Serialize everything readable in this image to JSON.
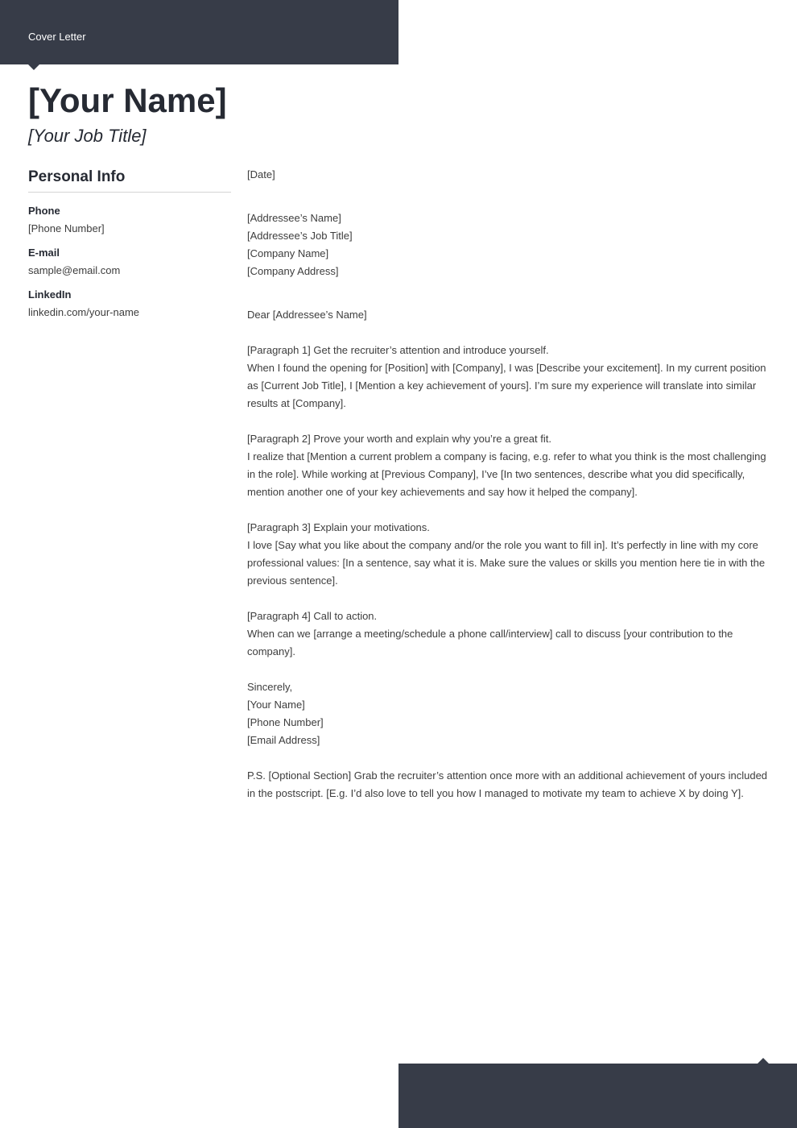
{
  "header": {
    "doc_type": "Cover Letter"
  },
  "applicant": {
    "name": "[Your Name]",
    "job_title": "[Your Job Title]"
  },
  "sidebar": {
    "section_title": "Personal Info",
    "items": [
      {
        "label": "Phone",
        "value": "[Phone Number]"
      },
      {
        "label": "E-mail",
        "value": "sample@email.com"
      },
      {
        "label": "LinkedIn",
        "value": "linkedin.com/your-name"
      }
    ]
  },
  "letter": {
    "date": "[Date]",
    "recipient": [
      "[Addressee’s Name]",
      "[Addressee’s Job Title]",
      "[Company Name]",
      "[Company Address]"
    ],
    "salutation": "Dear [Addressee’s Name]",
    "paragraphs": [
      {
        "heading": "[Paragraph 1] Get the recruiter’s attention and introduce yourself.",
        "body": "When I found the opening for [Position] with [Company], I was [Describe your excitement]. In my current position as [Current Job Title], I [Mention a key achievement of yours]. I’m sure my experience will translate into similar results at [Company]."
      },
      {
        "heading": "[Paragraph 2] Prove your worth and explain why you’re a great fit.",
        "body": "I realize that [Mention a current problem a company is facing, e.g. refer to what you think is the most challenging in the role]. While working at [Previous Company], I’ve [In two sentences, describe what you did specifically, mention another one of your key achievements and say how it helped the company]."
      },
      {
        "heading": "[Paragraph 3] Explain your motivations.",
        "body": "I love [Say what you like about the company and/or the role you want to fill in]. It’s perfectly in line with my core professional values: [In a sentence, say what it is. Make sure the values or skills you mention here tie in with the previous sentence]."
      },
      {
        "heading": "[Paragraph 4] Call to action.",
        "body": "When can we [arrange a meeting/schedule a phone call/interview] call to discuss [your contribution to the company]."
      }
    ],
    "closing": [
      "Sincerely,",
      "[Your Name]",
      "[Phone Number]",
      "[Email Address]"
    ],
    "postscript": "P.S. [Optional Section] Grab the recruiter’s attention once more with an additional achievement of yours included in the postscript. [E.g. I’d also love to tell you how I managed to motivate my team to achieve X by doing Y]."
  },
  "colors": {
    "banner": "#373c48",
    "heading_text": "#262a33",
    "body_text": "#3d3d3d",
    "divider": "#d5d5d5"
  }
}
